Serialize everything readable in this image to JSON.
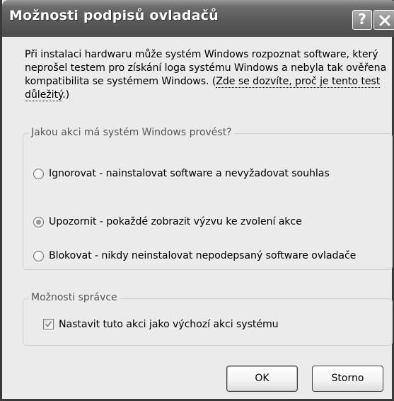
{
  "window": {
    "title": "Možnosti podpisů ovladačů",
    "help_label": "?"
  },
  "intro": {
    "text": "Při instalaci hardwaru může systém Windows rozpoznat software, který neprošel testem pro získání loga systému Windows a nebyla tak ověřena kompatibilita se systémem Windows. (",
    "link": "Zde se dozvíte, proč je tento test důležitý",
    "text_end": ".)"
  },
  "action_group": {
    "legend": "Jakou akci má systém Windows provést?",
    "options": [
      {
        "label": "Ignorovat - nainstalovat software a nevyžadovat souhlas",
        "selected": false
      },
      {
        "label": "Upozornit - pokaždé zobrazit výzvu ke zvolení akce",
        "selected": true
      },
      {
        "label": "Blokovat - nikdy neinstalovat nepodepsaný software ovladače",
        "selected": false
      }
    ]
  },
  "admin_group": {
    "legend": "Možnosti správce",
    "checkbox_label": "Nastavit tuto akci jako výchozí akci systému",
    "checked": true
  },
  "buttons": {
    "ok": "OK",
    "cancel": "Storno"
  },
  "icons": {
    "close": "close-icon",
    "help": "help-icon",
    "check": "checkmark-icon"
  }
}
